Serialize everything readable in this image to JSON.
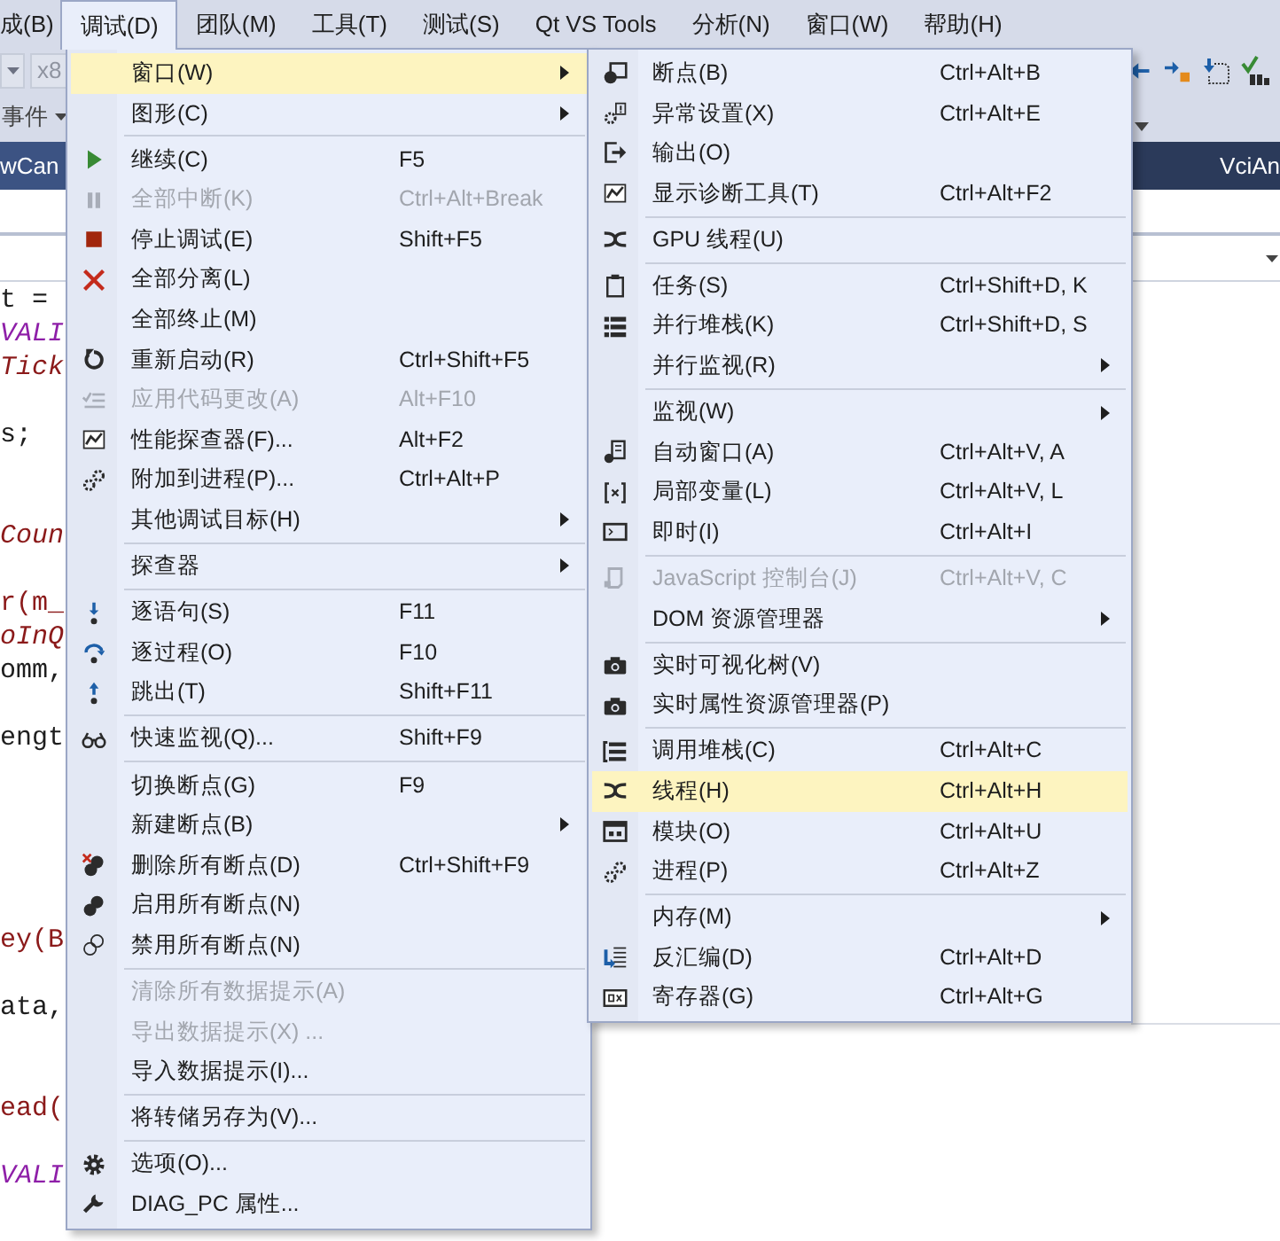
{
  "menubar": [
    {
      "label": "成(B)",
      "selected": false
    },
    {
      "label": "调试(D)",
      "selected": true
    },
    {
      "label": "团队(M)",
      "selected": false
    },
    {
      "label": "工具(T)",
      "selected": false
    },
    {
      "label": "测试(S)",
      "selected": false
    },
    {
      "label": "Qt VS Tools",
      "selected": false
    },
    {
      "label": "分析(N)",
      "selected": false
    },
    {
      "label": "窗口(W)",
      "selected": false
    },
    {
      "label": "帮助(H)",
      "selected": false
    }
  ],
  "toolbar": {
    "platform": "x8",
    "events": "事件"
  },
  "document_tabs": [
    {
      "label": "wCan"
    },
    {
      "label": "VciAn"
    }
  ],
  "code_lines": [
    {
      "kind": "plain",
      "text": "t ="
    },
    {
      "kind": "macro",
      "text": "VALI"
    },
    {
      "kind": "member",
      "text": "Tick"
    },
    {
      "kind": "blank"
    },
    {
      "kind": "plain",
      "text": "s;"
    },
    {
      "kind": "blank"
    },
    {
      "kind": "blank"
    },
    {
      "kind": "member",
      "text": "Coun"
    },
    {
      "kind": "blank"
    },
    {
      "kind": "function",
      "text": "r(m_"
    },
    {
      "kind": "member",
      "text": "oInQ"
    },
    {
      "kind": "plain",
      "text": "omm,"
    },
    {
      "kind": "blank"
    },
    {
      "kind": "plain",
      "text": "engt"
    },
    {
      "kind": "blank"
    },
    {
      "kind": "blank"
    },
    {
      "kind": "blank"
    },
    {
      "kind": "blank"
    },
    {
      "kind": "blank"
    },
    {
      "kind": "function",
      "text": "ey(B"
    },
    {
      "kind": "blank"
    },
    {
      "kind": "plain",
      "text": "ata,"
    },
    {
      "kind": "blank"
    },
    {
      "kind": "blank"
    },
    {
      "kind": "function",
      "text": "ead("
    },
    {
      "kind": "blank"
    },
    {
      "kind": "macro",
      "text": "VALI"
    }
  ],
  "debug_menu": {
    "items": [
      {
        "kind": "item",
        "label": "窗口(W)",
        "selected": true,
        "disabled": false,
        "submenu": true
      },
      {
        "kind": "item",
        "label": "图形(C)",
        "selected": false,
        "disabled": false,
        "submenu": true
      },
      {
        "kind": "separator"
      },
      {
        "kind": "item",
        "label": "继续(C)",
        "shortcut": "F5",
        "selected": false,
        "disabled": false,
        "submenu": false
      },
      {
        "kind": "item",
        "label": "全部中断(K)",
        "shortcut": "Ctrl+Alt+Break",
        "selected": false,
        "disabled": true,
        "submenu": false
      },
      {
        "kind": "item",
        "label": "停止调试(E)",
        "shortcut": "Shift+F5",
        "selected": false,
        "disabled": false,
        "submenu": false
      },
      {
        "kind": "item",
        "label": "全部分离(L)",
        "selected": false,
        "disabled": false,
        "submenu": false
      },
      {
        "kind": "item",
        "label": "全部终止(M)",
        "selected": false,
        "disabled": false,
        "submenu": false
      },
      {
        "kind": "item",
        "label": "重新启动(R)",
        "shortcut": "Ctrl+Shift+F5",
        "selected": false,
        "disabled": false,
        "submenu": false
      },
      {
        "kind": "item",
        "label": "应用代码更改(A)",
        "shortcut": "Alt+F10",
        "selected": false,
        "disabled": true,
        "submenu": false
      },
      {
        "kind": "item",
        "label": "性能探查器(F)...",
        "shortcut": "Alt+F2",
        "selected": false,
        "disabled": false,
        "submenu": false
      },
      {
        "kind": "item",
        "label": "附加到进程(P)...",
        "shortcut": "Ctrl+Alt+P",
        "selected": false,
        "disabled": false,
        "submenu": false
      },
      {
        "kind": "item",
        "label": "其他调试目标(H)",
        "selected": false,
        "disabled": false,
        "submenu": true
      },
      {
        "kind": "separator"
      },
      {
        "kind": "item",
        "label": "探查器",
        "selected": false,
        "disabled": false,
        "submenu": true
      },
      {
        "kind": "separator"
      },
      {
        "kind": "item",
        "label": "逐语句(S)",
        "shortcut": "F11",
        "selected": false,
        "disabled": false,
        "submenu": false
      },
      {
        "kind": "item",
        "label": "逐过程(O)",
        "shortcut": "F10",
        "selected": false,
        "disabled": false,
        "submenu": false
      },
      {
        "kind": "item",
        "label": "跳出(T)",
        "shortcut": "Shift+F11",
        "selected": false,
        "disabled": false,
        "submenu": false
      },
      {
        "kind": "separator"
      },
      {
        "kind": "item",
        "label": "快速监视(Q)...",
        "shortcut": "Shift+F9",
        "selected": false,
        "disabled": false,
        "submenu": false
      },
      {
        "kind": "separator"
      },
      {
        "kind": "item",
        "label": "切换断点(G)",
        "shortcut": "F9",
        "selected": false,
        "disabled": false,
        "submenu": false
      },
      {
        "kind": "item",
        "label": "新建断点(B)",
        "selected": false,
        "disabled": false,
        "submenu": true
      },
      {
        "kind": "item",
        "label": "删除所有断点(D)",
        "shortcut": "Ctrl+Shift+F9",
        "selected": false,
        "disabled": false,
        "submenu": false
      },
      {
        "kind": "item",
        "label": "启用所有断点(N)",
        "selected": false,
        "disabled": false,
        "submenu": false
      },
      {
        "kind": "item",
        "label": "禁用所有断点(N)",
        "selected": false,
        "disabled": false,
        "submenu": false
      },
      {
        "kind": "separator"
      },
      {
        "kind": "item",
        "label": "清除所有数据提示(A)",
        "selected": false,
        "disabled": true,
        "submenu": false
      },
      {
        "kind": "item",
        "label": "导出数据提示(X) ...",
        "selected": false,
        "disabled": true,
        "submenu": false
      },
      {
        "kind": "item",
        "label": "导入数据提示(I)...",
        "selected": false,
        "disabled": false,
        "submenu": false
      },
      {
        "kind": "separator"
      },
      {
        "kind": "item",
        "label": "将转储另存为(V)...",
        "selected": false,
        "disabled": false,
        "submenu": false
      },
      {
        "kind": "separator"
      },
      {
        "kind": "item",
        "label": "选项(O)...",
        "selected": false,
        "disabled": false,
        "submenu": false
      },
      {
        "kind": "item",
        "label": "DIAG_PC 属性...",
        "selected": false,
        "disabled": false,
        "submenu": false
      }
    ]
  },
  "window_submenu": {
    "items": [
      {
        "kind": "item",
        "label": "断点(B)",
        "shortcut": "Ctrl+Alt+B",
        "selected": false,
        "disabled": false,
        "submenu": false
      },
      {
        "kind": "item",
        "label": "异常设置(X)",
        "shortcut": "Ctrl+Alt+E",
        "selected": false,
        "disabled": false,
        "submenu": false
      },
      {
        "kind": "item",
        "label": "输出(O)",
        "selected": false,
        "disabled": false,
        "submenu": false
      },
      {
        "kind": "item",
        "label": "显示诊断工具(T)",
        "shortcut": "Ctrl+Alt+F2",
        "selected": false,
        "disabled": false,
        "submenu": false
      },
      {
        "kind": "separator"
      },
      {
        "kind": "item",
        "label": "GPU 线程(U)",
        "selected": false,
        "disabled": false,
        "submenu": false
      },
      {
        "kind": "separator"
      },
      {
        "kind": "item",
        "label": "任务(S)",
        "shortcut": "Ctrl+Shift+D, K",
        "selected": false,
        "disabled": false,
        "submenu": false
      },
      {
        "kind": "item",
        "label": "并行堆栈(K)",
        "shortcut": "Ctrl+Shift+D, S",
        "selected": false,
        "disabled": false,
        "submenu": false
      },
      {
        "kind": "item",
        "label": "并行监视(R)",
        "selected": false,
        "disabled": false,
        "submenu": true
      },
      {
        "kind": "separator"
      },
      {
        "kind": "item",
        "label": "监视(W)",
        "selected": false,
        "disabled": false,
        "submenu": true
      },
      {
        "kind": "item",
        "label": "自动窗口(A)",
        "shortcut": "Ctrl+Alt+V, A",
        "selected": false,
        "disabled": false,
        "submenu": false
      },
      {
        "kind": "item",
        "label": "局部变量(L)",
        "shortcut": "Ctrl+Alt+V, L",
        "selected": false,
        "disabled": false,
        "submenu": false
      },
      {
        "kind": "item",
        "label": "即时(I)",
        "shortcut": "Ctrl+Alt+I",
        "selected": false,
        "disabled": false,
        "submenu": false
      },
      {
        "kind": "separator"
      },
      {
        "kind": "item",
        "label": "JavaScript 控制台(J)",
        "shortcut": "Ctrl+Alt+V, C",
        "selected": false,
        "disabled": true,
        "submenu": false
      },
      {
        "kind": "item",
        "label": "DOM 资源管理器",
        "selected": false,
        "disabled": false,
        "submenu": true
      },
      {
        "kind": "separator"
      },
      {
        "kind": "item",
        "label": "实时可视化树(V)",
        "selected": false,
        "disabled": false,
        "submenu": false
      },
      {
        "kind": "item",
        "label": "实时属性资源管理器(P)",
        "selected": false,
        "disabled": false,
        "submenu": false
      },
      {
        "kind": "separator"
      },
      {
        "kind": "item",
        "label": "调用堆栈(C)",
        "shortcut": "Ctrl+Alt+C",
        "selected": false,
        "disabled": false,
        "submenu": false
      },
      {
        "kind": "item",
        "label": "线程(H)",
        "shortcut": "Ctrl+Alt+H",
        "selected": true,
        "disabled": false,
        "submenu": false
      },
      {
        "kind": "item",
        "label": "模块(O)",
        "shortcut": "Ctrl+Alt+U",
        "selected": false,
        "disabled": false,
        "submenu": false
      },
      {
        "kind": "item",
        "label": "进程(P)",
        "shortcut": "Ctrl+Alt+Z",
        "selected": false,
        "disabled": false,
        "submenu": false
      },
      {
        "kind": "separator"
      },
      {
        "kind": "item",
        "label": "内存(M)",
        "selected": false,
        "disabled": false,
        "submenu": true
      },
      {
        "kind": "item",
        "label": "反汇编(D)",
        "shortcut": "Ctrl+Alt+D",
        "selected": false,
        "disabled": false,
        "submenu": false
      },
      {
        "kind": "item",
        "label": "寄存器(G)",
        "shortcut": "Ctrl+Alt+G",
        "selected": false,
        "disabled": false,
        "submenu": false
      }
    ]
  }
}
